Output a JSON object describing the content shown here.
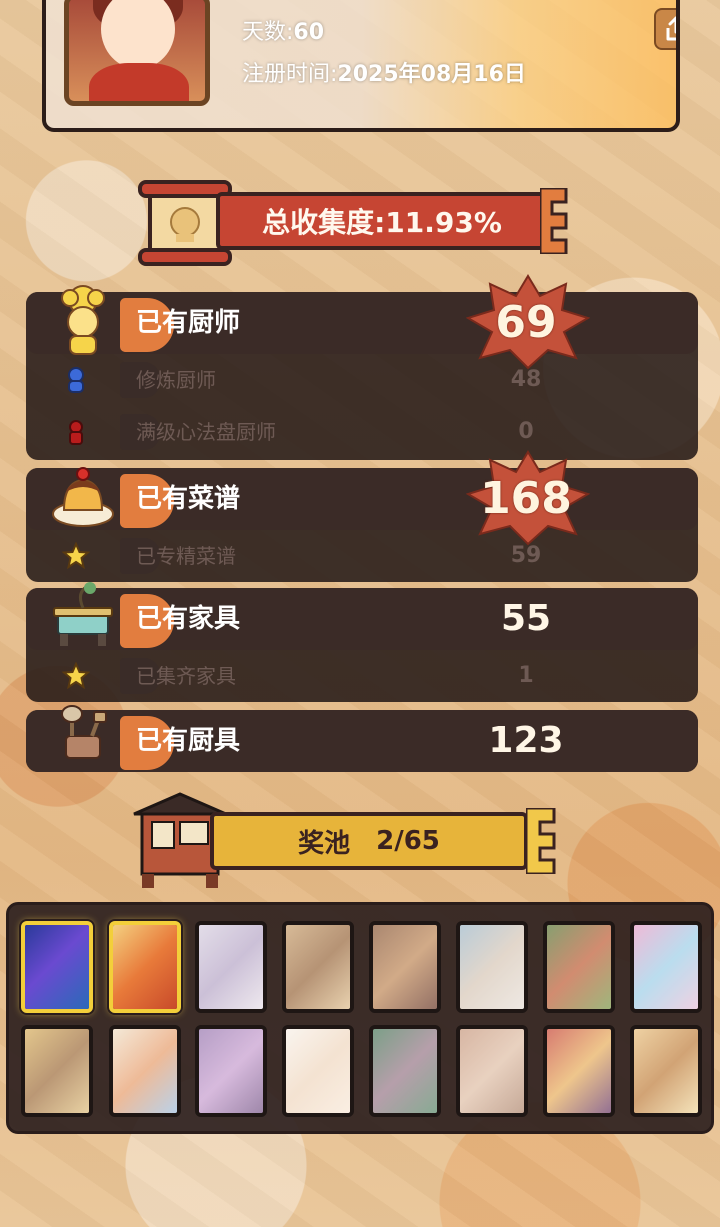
{
  "profile": {
    "days_label": "天数:",
    "days_value": "60",
    "register_label": "注册时间:",
    "register_value": "2025年08月16日",
    "share_icon": "share-upload-icon"
  },
  "collection_banner": {
    "text": "总收集度:11.93%"
  },
  "chefs": {
    "title": "已有厨师",
    "count": "69",
    "rows": [
      {
        "label": "修炼厨师",
        "value": "48",
        "icon": "blue-figure-icon"
      },
      {
        "label": "满级心法盘厨师",
        "value": "0",
        "icon": "red-figure-icon"
      }
    ]
  },
  "recipes": {
    "title": "已有菜谱",
    "count": "168",
    "rows": [
      {
        "label": "已专精菜谱",
        "value": "59",
        "icon": "star-icon"
      }
    ]
  },
  "furniture": {
    "title": "已有家具",
    "count": "55",
    "rows": [
      {
        "label": "已集齐家具",
        "value": "1",
        "icon": "star-icon"
      }
    ]
  },
  "utensils": {
    "title": "已有厨具",
    "count": "123"
  },
  "prize_pool": {
    "title": "奖池",
    "progress": "2/65"
  },
  "colors": {
    "ribbon_red": "#c64533",
    "ribbon_gold": "#e7b43a",
    "accent_orange": "#e27d3f",
    "panel_dark": "#3b2b27",
    "starburst": "#c4513a"
  }
}
